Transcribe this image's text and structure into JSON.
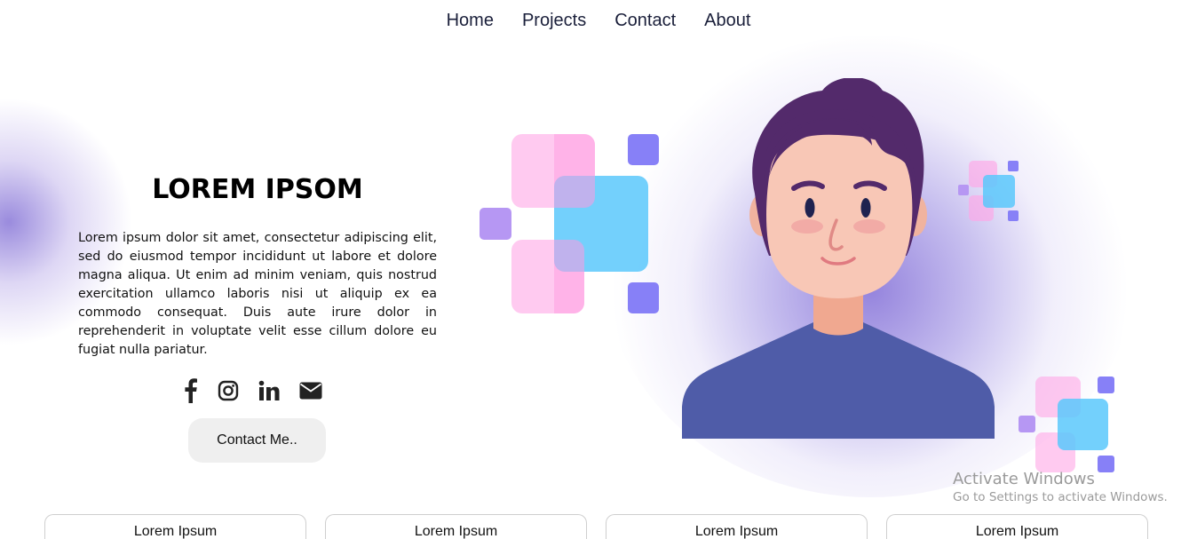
{
  "nav": {
    "items": [
      {
        "label": "Home"
      },
      {
        "label": "Projects"
      },
      {
        "label": "Contact"
      },
      {
        "label": "About"
      }
    ]
  },
  "hero": {
    "title": "LOREM IPSOM",
    "paragraph": "Lorem ipsum dolor sit amet, consectetur adipiscing elit, sed do eiusmod tempor incididunt ut labore et dolore magna aliqua. Ut enim ad minim veniam, quis nostrud exercitation ullamco laboris nisi ut aliquip ex ea commodo consequat. Duis aute irure dolor in reprehenderit in voluptate velit esse cillum dolore eu fugiat nulla pariatur.",
    "socials": [
      "facebook-icon",
      "instagram-icon",
      "linkedin-icon",
      "envelope-icon"
    ],
    "contact_button": "Contact Me.."
  },
  "illustration": {
    "name": "person-avatar",
    "colors": {
      "hair": "#532a6b",
      "skin": "#f6c3b3",
      "shirt": "#4f5ca8",
      "pink": "#ffa6e6",
      "blue": "#5bc8fc",
      "purple": "#7d74f5",
      "glow": "#7a68d2"
    }
  },
  "watermark": {
    "title": "Activate Windows",
    "subtitle": "Go to Settings to activate Windows."
  },
  "cards": [
    {
      "label": "Lorem Ipsum"
    },
    {
      "label": "Lorem Ipsum"
    },
    {
      "label": "Lorem Ipsum"
    },
    {
      "label": "Lorem Ipsum"
    }
  ]
}
